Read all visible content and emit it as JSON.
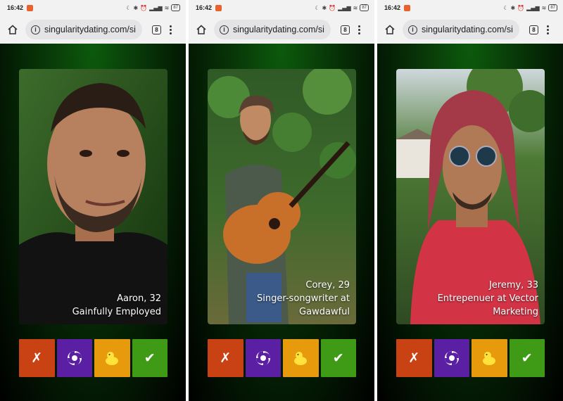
{
  "status_bar": {
    "time": "16:42",
    "battery": "87"
  },
  "browser": {
    "url": "singularitydating.com/si",
    "tab_count": "8"
  },
  "colors": {
    "reject": "#c84214",
    "portal": "#5b1fa4",
    "duck": "#e79a0c",
    "accept": "#3f9b15",
    "background_glow": "#0c5a0c"
  },
  "actions": {
    "reject_glyph": "✗",
    "accept_glyph": "✔",
    "portal_icon": "swirl-icon",
    "duck_icon": "rubber-duck-icon"
  },
  "profiles": [
    {
      "name_age": "Aaron, 32",
      "tagline": "Gainfully Employed"
    },
    {
      "name_age": "Corey, 29",
      "tagline": "Singer-songwriter at Gawdawful"
    },
    {
      "name_age": "Jeremy, 33",
      "tagline": "Entrepenuer at Vector Marketing"
    }
  ]
}
